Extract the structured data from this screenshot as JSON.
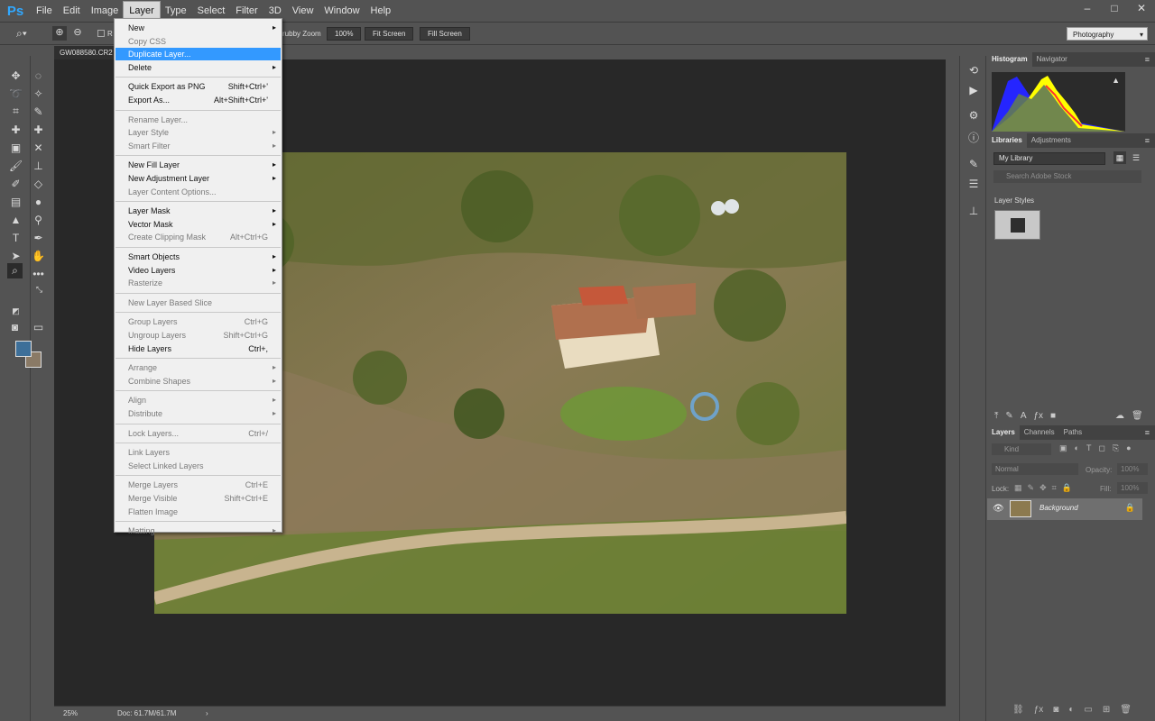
{
  "app": {
    "logo": "Ps"
  },
  "menubar": {
    "items": [
      {
        "label": "File"
      },
      {
        "label": "Edit"
      },
      {
        "label": "Image"
      },
      {
        "label": "Layer"
      },
      {
        "label": "Type"
      },
      {
        "label": "Select"
      },
      {
        "label": "Filter"
      },
      {
        "label": "3D"
      },
      {
        "label": "View"
      },
      {
        "label": "Window"
      },
      {
        "label": "Help"
      }
    ],
    "active": "Layer",
    "window_controls": [
      "–",
      "□",
      "✕"
    ]
  },
  "options_bar": {
    "partial_checkbox_label": "R",
    "scrubby_label": "rubby Zoom",
    "zoom_100": "100%",
    "fit_screen": "Fit Screen",
    "fill_screen": "Fill Screen",
    "workspace": "Photography"
  },
  "document": {
    "tab": "GW088580.CR2",
    "zoom": "25%",
    "doc_info": "Doc: 61.7M/61.7M",
    "arrow": "›"
  },
  "layer_menu": {
    "items": [
      {
        "label": "New",
        "submenu": true
      },
      {
        "label": "Copy CSS",
        "disabled": true
      },
      {
        "label": "Duplicate Layer...",
        "highlighted": true
      },
      {
        "label": "Delete",
        "submenu": true
      },
      {
        "sep": true
      },
      {
        "label": "Quick Export as PNG",
        "shortcut": "Shift+Ctrl+'"
      },
      {
        "label": "Export As...",
        "shortcut": "Alt+Shift+Ctrl+'"
      },
      {
        "sep": true
      },
      {
        "label": "Rename Layer...",
        "disabled": true
      },
      {
        "label": "Layer Style",
        "submenu": true,
        "disabled": true
      },
      {
        "label": "Smart Filter",
        "submenu": true,
        "disabled": true
      },
      {
        "sep": true
      },
      {
        "label": "New Fill Layer",
        "submenu": true
      },
      {
        "label": "New Adjustment Layer",
        "submenu": true
      },
      {
        "label": "Layer Content Options...",
        "disabled": true
      },
      {
        "sep": true
      },
      {
        "label": "Layer Mask",
        "submenu": true
      },
      {
        "label": "Vector Mask",
        "submenu": true
      },
      {
        "label": "Create Clipping Mask",
        "shortcut": "Alt+Ctrl+G",
        "disabled": true
      },
      {
        "sep": true
      },
      {
        "label": "Smart Objects",
        "submenu": true
      },
      {
        "label": "Video Layers",
        "submenu": true
      },
      {
        "label": "Rasterize",
        "submenu": true,
        "disabled": true
      },
      {
        "sep": true
      },
      {
        "label": "New Layer Based Slice",
        "disabled": true
      },
      {
        "sep": true
      },
      {
        "label": "Group Layers",
        "shortcut": "Ctrl+G",
        "disabled": true
      },
      {
        "label": "Ungroup Layers",
        "shortcut": "Shift+Ctrl+G",
        "disabled": true
      },
      {
        "label": "Hide Layers",
        "shortcut": "Ctrl+,"
      },
      {
        "sep": true
      },
      {
        "label": "Arrange",
        "submenu": true,
        "disabled": true
      },
      {
        "label": "Combine Shapes",
        "submenu": true,
        "disabled": true
      },
      {
        "sep": true
      },
      {
        "label": "Align",
        "submenu": true,
        "disabled": true
      },
      {
        "label": "Distribute",
        "submenu": true,
        "disabled": true
      },
      {
        "sep": true
      },
      {
        "label": "Lock Layers...",
        "shortcut": "Ctrl+/",
        "disabled": true
      },
      {
        "sep": true
      },
      {
        "label": "Link Layers",
        "disabled": true
      },
      {
        "label": "Select Linked Layers",
        "disabled": true
      },
      {
        "sep": true
      },
      {
        "label": "Merge Layers",
        "shortcut": "Ctrl+E",
        "disabled": true
      },
      {
        "label": "Merge Visible",
        "shortcut": "Shift+Ctrl+E",
        "disabled": true
      },
      {
        "label": "Flatten Image",
        "disabled": true
      },
      {
        "sep": true
      },
      {
        "label": "Matting",
        "submenu": true,
        "disabled": true
      }
    ]
  },
  "panels": {
    "histogram_tabs": [
      "Histogram",
      "Navigator"
    ],
    "libraries_tabs": [
      "Libraries",
      "Adjustments"
    ],
    "library_select": "My Library",
    "stock_search_placeholder": "Search Adobe Stock",
    "layer_styles_label": "Layer Styles",
    "layers_tabs": [
      "Layers",
      "Channels",
      "Paths"
    ],
    "kind_label": "Kind",
    "blend_mode": "Normal",
    "opacity_label": "Opacity:",
    "opacity_value": "100%",
    "lock_label": "Lock:",
    "fill_label": "Fill:",
    "fill_value": "100%",
    "layers": [
      {
        "name": "Background",
        "visible": true,
        "locked": true
      }
    ]
  },
  "colors": {
    "foreground": "#3d6f99",
    "background": "#8a7a66",
    "menu_highlight": "#3399ff"
  }
}
